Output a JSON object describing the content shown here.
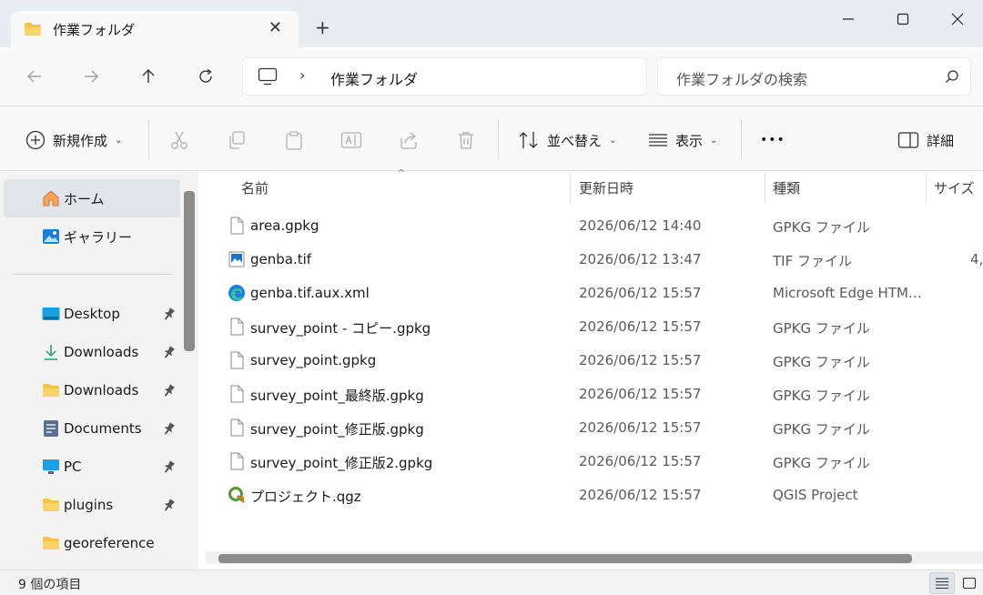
{
  "tab": {
    "title": "作業フォルダ",
    "close": "✕",
    "new_tab": "+"
  },
  "window": {
    "minimize": "—",
    "maximize": "☐",
    "close": "✕"
  },
  "address": {
    "separator": "›",
    "crumb": "作業フォルダ"
  },
  "search": {
    "placeholder": "作業フォルダの検索"
  },
  "commands": {
    "new": "新規作成",
    "sort": "並べ替え",
    "view": "表示",
    "more": "•••",
    "details": "詳細"
  },
  "nav": {
    "items": [
      {
        "label": "ホーム",
        "icon": "home-icon"
      },
      {
        "label": "ギャラリー",
        "icon": "gallery-icon"
      },
      {
        "label": "Desktop",
        "icon": "desktop-folder-icon",
        "pinned": true
      },
      {
        "label": "Downloads",
        "icon": "download-arrow-icon",
        "pinned": true
      },
      {
        "label": "Downloads",
        "icon": "folder-icon",
        "pinned": true
      },
      {
        "label": "Documents",
        "icon": "documents-icon",
        "pinned": true
      },
      {
        "label": "PC",
        "icon": "pc-monitor-icon",
        "pinned": true
      },
      {
        "label": "plugins",
        "icon": "folder-icon",
        "pinned": true
      },
      {
        "label": "georeference",
        "icon": "folder-icon",
        "pinned": false
      }
    ]
  },
  "columns": {
    "name": "名前",
    "date": "更新日時",
    "type": "種類",
    "size": "サイズ"
  },
  "files": [
    {
      "name": "area.gpkg",
      "date": "2026/06/12 14:40",
      "type": "GPKG ファイル",
      "size": "",
      "icon": "generic-file-icon"
    },
    {
      "name": "genba.tif",
      "date": "2026/06/12 13:47",
      "type": "TIF ファイル",
      "size": "4,",
      "icon": "image-file-icon"
    },
    {
      "name": "genba.tif.aux.xml",
      "date": "2026/06/12 15:57",
      "type": "Microsoft Edge HTM…",
      "size": "",
      "icon": "edge-icon"
    },
    {
      "name": "survey_point - コピー.gpkg",
      "date": "2026/06/12 15:57",
      "type": "GPKG ファイル",
      "size": "",
      "icon": "generic-file-icon"
    },
    {
      "name": "survey_point.gpkg",
      "date": "2026/06/12 15:57",
      "type": "GPKG ファイル",
      "size": "",
      "icon": "generic-file-icon"
    },
    {
      "name": "survey_point_最終版.gpkg",
      "date": "2026/06/12 15:57",
      "type": "GPKG ファイル",
      "size": "",
      "icon": "generic-file-icon"
    },
    {
      "name": "survey_point_修正版.gpkg",
      "date": "2026/06/12 15:57",
      "type": "GPKG ファイル",
      "size": "",
      "icon": "generic-file-icon"
    },
    {
      "name": "survey_point_修正版2.gpkg",
      "date": "2026/06/12 15:57",
      "type": "GPKG ファイル",
      "size": "",
      "icon": "generic-file-icon"
    },
    {
      "name": "プロジェクト.qgz",
      "date": "2026/06/12 15:57",
      "type": "QGIS Project",
      "size": "",
      "icon": "qgis-icon"
    }
  ],
  "status": {
    "count": "9 個の項目"
  },
  "colors": {
    "accent": "#005fb8",
    "folder": "#f4c542",
    "qgis_green": "#589632",
    "edge_blue": "#1f7fd6"
  }
}
